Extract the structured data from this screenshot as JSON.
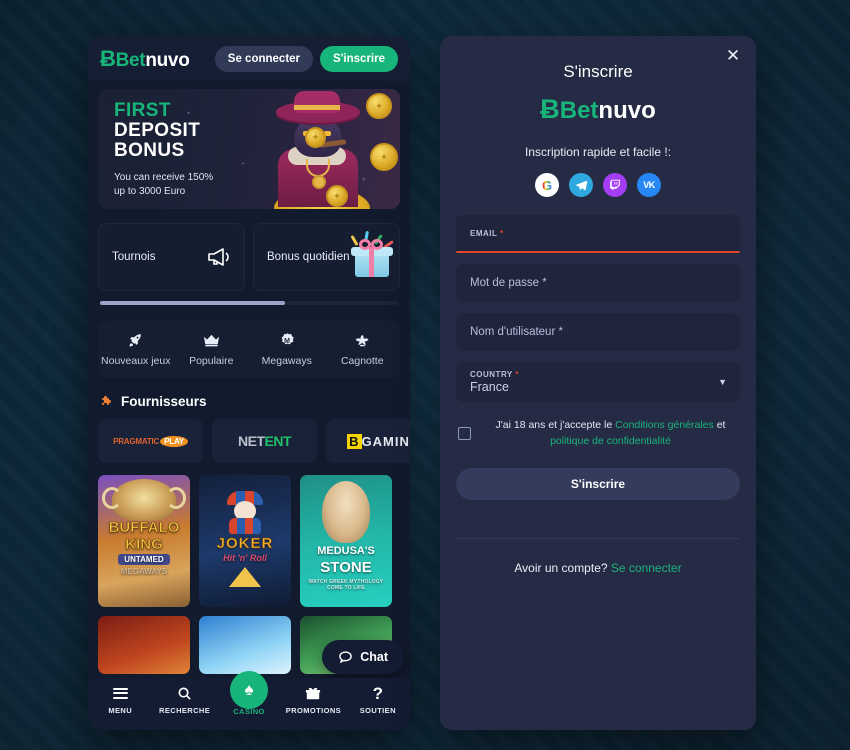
{
  "site": {
    "brand_mark": "Ᏼ",
    "brand_first": "Bet",
    "brand_second": "nuvo",
    "accent_green": "#18b57a",
    "error_red": "#e0452d"
  },
  "phone": {
    "header": {
      "login_label": "Se connecter",
      "signup_label": "S'inscrire"
    },
    "banner": {
      "line1": "FIRST",
      "line2": "DEPOSIT",
      "line3": "BONUS",
      "sub_line1": "You can receive 150%",
      "sub_line2": "up to 3000 Euro"
    },
    "promos": [
      {
        "label": "Tournois",
        "icon": "megaphone-icon"
      },
      {
        "label": "Bonus quotidien",
        "icon": "gift-icon"
      }
    ],
    "categories": [
      {
        "label": "Nouveaux jeux",
        "icon": "rocket-icon",
        "glyph": "🚀"
      },
      {
        "label": "Populaire",
        "icon": "crown-icon",
        "glyph": "♕"
      },
      {
        "label": "Megaways",
        "icon": "megaways-icon",
        "glyph": "Ⓜ"
      },
      {
        "label": "Cagnotte",
        "icon": "jackpot-icon",
        "glyph": "❦"
      }
    ],
    "providers_section": {
      "title": "Fournisseurs",
      "icon": "puzzle-icon"
    },
    "providers": [
      {
        "name": "PRAGMATIC PLAY",
        "part1": "PRAGMATIC",
        "part2": "PLAY"
      },
      {
        "name": "NETENT",
        "part1": "NET",
        "part2": "ENT"
      },
      {
        "name": "BGAMING",
        "part1": "B",
        "part2": "GAMIN"
      }
    ],
    "games": [
      {
        "title_1": "BUFFALO",
        "title_2": "KING",
        "title_3": "UNTAMED",
        "title_4": "MEGAWAYS"
      },
      {
        "title_1": "JOKER",
        "title_2": "Hit 'n' Roll"
      },
      {
        "title_1": "MEDUSA'S",
        "title_2": "STONE",
        "title_3": "WATCH GREEK MYTHOLOGY COME TO LIFE"
      }
    ],
    "chat": {
      "label": "Chat",
      "icon": "chat-bubble-icon"
    },
    "bottom_nav": [
      {
        "label": "MENU",
        "icon": "hamburger-icon"
      },
      {
        "label": "RECHERCHE",
        "icon": "search-icon",
        "glyph": "⌕"
      },
      {
        "label": "CASINO",
        "icon": "spade-icon",
        "glyph": "♠"
      },
      {
        "label": "PROMOTIONS",
        "icon": "gift-icon",
        "glyph": "🎁"
      },
      {
        "label": "SOUTIEN",
        "icon": "question-mark-icon",
        "glyph": "?"
      }
    ]
  },
  "register": {
    "close_icon": "close-icon",
    "title": "S'inscrire",
    "subtitle": "Inscription rapide et facile !:",
    "socials": [
      {
        "name": "google-icon",
        "glyph": "G"
      },
      {
        "name": "telegram-icon",
        "glyph": "➤"
      },
      {
        "name": "twitch-icon",
        "glyph": "⌷"
      },
      {
        "name": "vk-icon",
        "glyph": "VK"
      }
    ],
    "fields": {
      "email": {
        "label": "EMAIL",
        "required": "*",
        "value": "",
        "state": "error"
      },
      "password": {
        "placeholder": "Mot de passe *"
      },
      "username": {
        "placeholder": "Nom d'utilisateur *"
      },
      "country": {
        "label": "COUNTRY",
        "required": "*",
        "value": "France",
        "caret": "chevron-down-icon"
      }
    },
    "terms": {
      "text_before": "J'ai 18 ans et j'accepte le ",
      "link1": "Conditions générales",
      "text_mid": " et",
      "link2": "politique de confidentialité",
      "checked": false
    },
    "submit_label": "S'inscrire",
    "footer": {
      "text": "Avoir un compte?",
      "link": "Se connecter"
    }
  }
}
